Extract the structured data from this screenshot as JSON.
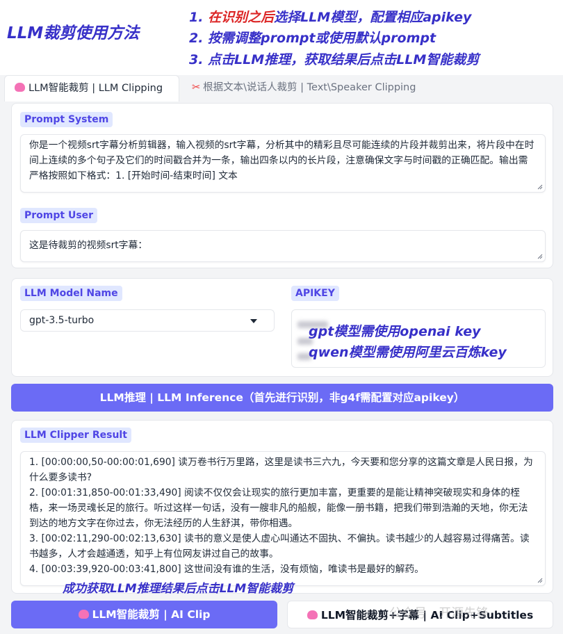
{
  "guide": {
    "title": "LLM裁剪使用方法",
    "step1_prefix": "1. ",
    "step1_red": "在识别之后",
    "step1_rest": "选择LLM模型，配置相应apikey",
    "step2": "2. 按需调整prompt或使用默认prompt",
    "step3": "3. 点击LLM推理，获取结果后点击LLM智能裁剪"
  },
  "tabs": [
    {
      "label": "LLM智能裁剪 | LLM Clipping",
      "icon": "brain-icon",
      "active": true
    },
    {
      "label": "根据文本\\说话人裁剪 | Text\\Speaker Clipping",
      "icon": "scissors-icon",
      "active": false
    }
  ],
  "prompt_system": {
    "label": "Prompt System",
    "value": "你是一个视频srt字幕分析剪辑器，输入视频的srt字幕，分析其中的精彩且尽可能连续的片段并裁剪出来，将片段中在时间上连续的多个句子及它们的时间戳合并为一条，输出四条以内的长片段，注意确保文字与时间戳的正确匹配。输出需严格按照如下格式：1. [开始时间-结束时间] 文本"
  },
  "prompt_user": {
    "label": "Prompt User",
    "value": "这是待裁剪的视频srt字幕："
  },
  "llm_model": {
    "label": "LLM Model Name",
    "selected": "gpt-3.5-turbo"
  },
  "apikey": {
    "label": "APIKEY",
    "note1": "gpt模型需使用openai key",
    "note2": "qwen模型需使用阿里云百炼key"
  },
  "inference_button": "LLM推理 | LLM Inference（首先进行识别，非g4f需配置对应apikey）",
  "result": {
    "label": "LLM Clipper Result",
    "lines": [
      "1. [00:00:00,50-00:00:01,690] 读万卷书行万里路，这里是读书三六九，今天要和您分享的这篇文章是人民日报，为什么要多读书?",
      "2. [00:01:31,850-00:01:33,490] 阅读不仅仅会让现实的旅行更加丰富，更重要的是能让精神突破现实和身体的桎梏，来一场灵魂长足的旅行。听过这样一句话，没有一艘非凡的船舰，能像一册书籍，把我们带到浩瀚的天地，你无法到达的地方文字在你过去，你无法经历的人生舒淇，带你相遇。",
      "3. [00:02:11,290-00:02:13,630] 读书的意义是使人虚心叫通达不固执、不偏执。读书越少的人越容易过得痛苦。读书越多，人才会越通透，知乎上有位网友讲过自己的故事。",
      "4. [00:03:39,920-00:03:41,800] 这世间没有谁的生活，没有烦恼，唯读书是最好的解药。"
    ]
  },
  "success_note": "成功获取LLM推理结果后点击LLM智能裁剪",
  "clip_button": "LLM智能裁剪 | AI Clip",
  "clip_subtitles_button": "LLM智能裁剪+字幕 | AI Clip+Subtitles",
  "watermark": "公众号 · 开源先锋"
}
